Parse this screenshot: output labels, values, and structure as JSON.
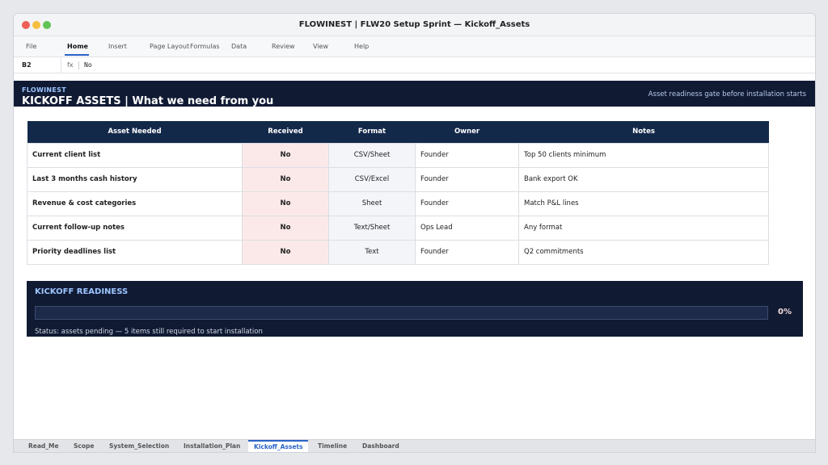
{
  "window": {
    "title": "FLOWINEST | FLW20 Setup Sprint — Kickoff_Assets"
  },
  "ribbon": {
    "tabs": [
      "File",
      "Home",
      "Insert",
      "Page Layout",
      "Formulas",
      "Data",
      "Review",
      "View",
      "Help"
    ],
    "active": "Home"
  },
  "formula_bar": {
    "cell": "B2",
    "fx": "fx",
    "value": "No"
  },
  "banner": {
    "brand": "FLOWINEST",
    "title": "KICKOFF ASSETS | What we need from you",
    "subtitle": "Asset readiness gate before installation starts"
  },
  "table": {
    "headers": [
      "Asset Needed",
      "Received",
      "Format",
      "Owner",
      "Notes"
    ],
    "rows": [
      {
        "asset": "Current client list",
        "received": "No",
        "format": "CSV/Sheet",
        "owner": "Founder",
        "notes": "Top 50 clients minimum"
      },
      {
        "asset": "Last 3 months cash history",
        "received": "No",
        "format": "CSV/Excel",
        "owner": "Founder",
        "notes": "Bank export OK"
      },
      {
        "asset": "Revenue & cost categories",
        "received": "No",
        "format": "Sheet",
        "owner": "Founder",
        "notes": "Match P&L lines"
      },
      {
        "asset": "Current follow-up notes",
        "received": "No",
        "format": "Text/Sheet",
        "owner": "Ops Lead",
        "notes": "Any format"
      },
      {
        "asset": "Priority deadlines list",
        "received": "No",
        "format": "Text",
        "owner": "Founder",
        "notes": "Q2 commitments"
      }
    ]
  },
  "readiness": {
    "title": "KICKOFF READINESS",
    "progress": 0,
    "percent_label": "0%",
    "status": "Status: assets pending — 5 items still required to start installation"
  },
  "sheet_tabs": {
    "tabs": [
      "Read_Me",
      "Scope",
      "System_Selection",
      "Installation_Plan",
      "Kickoff_Assets",
      "Timeline",
      "Dashboard"
    ],
    "active": "Kickoff_Assets"
  },
  "colors": {
    "banner_bg": "#101a33",
    "header_bg": "#13294a",
    "accent": "#2a63c7",
    "not_received_text": "#b32b2b",
    "not_received_bg": "#fbe9e9"
  }
}
